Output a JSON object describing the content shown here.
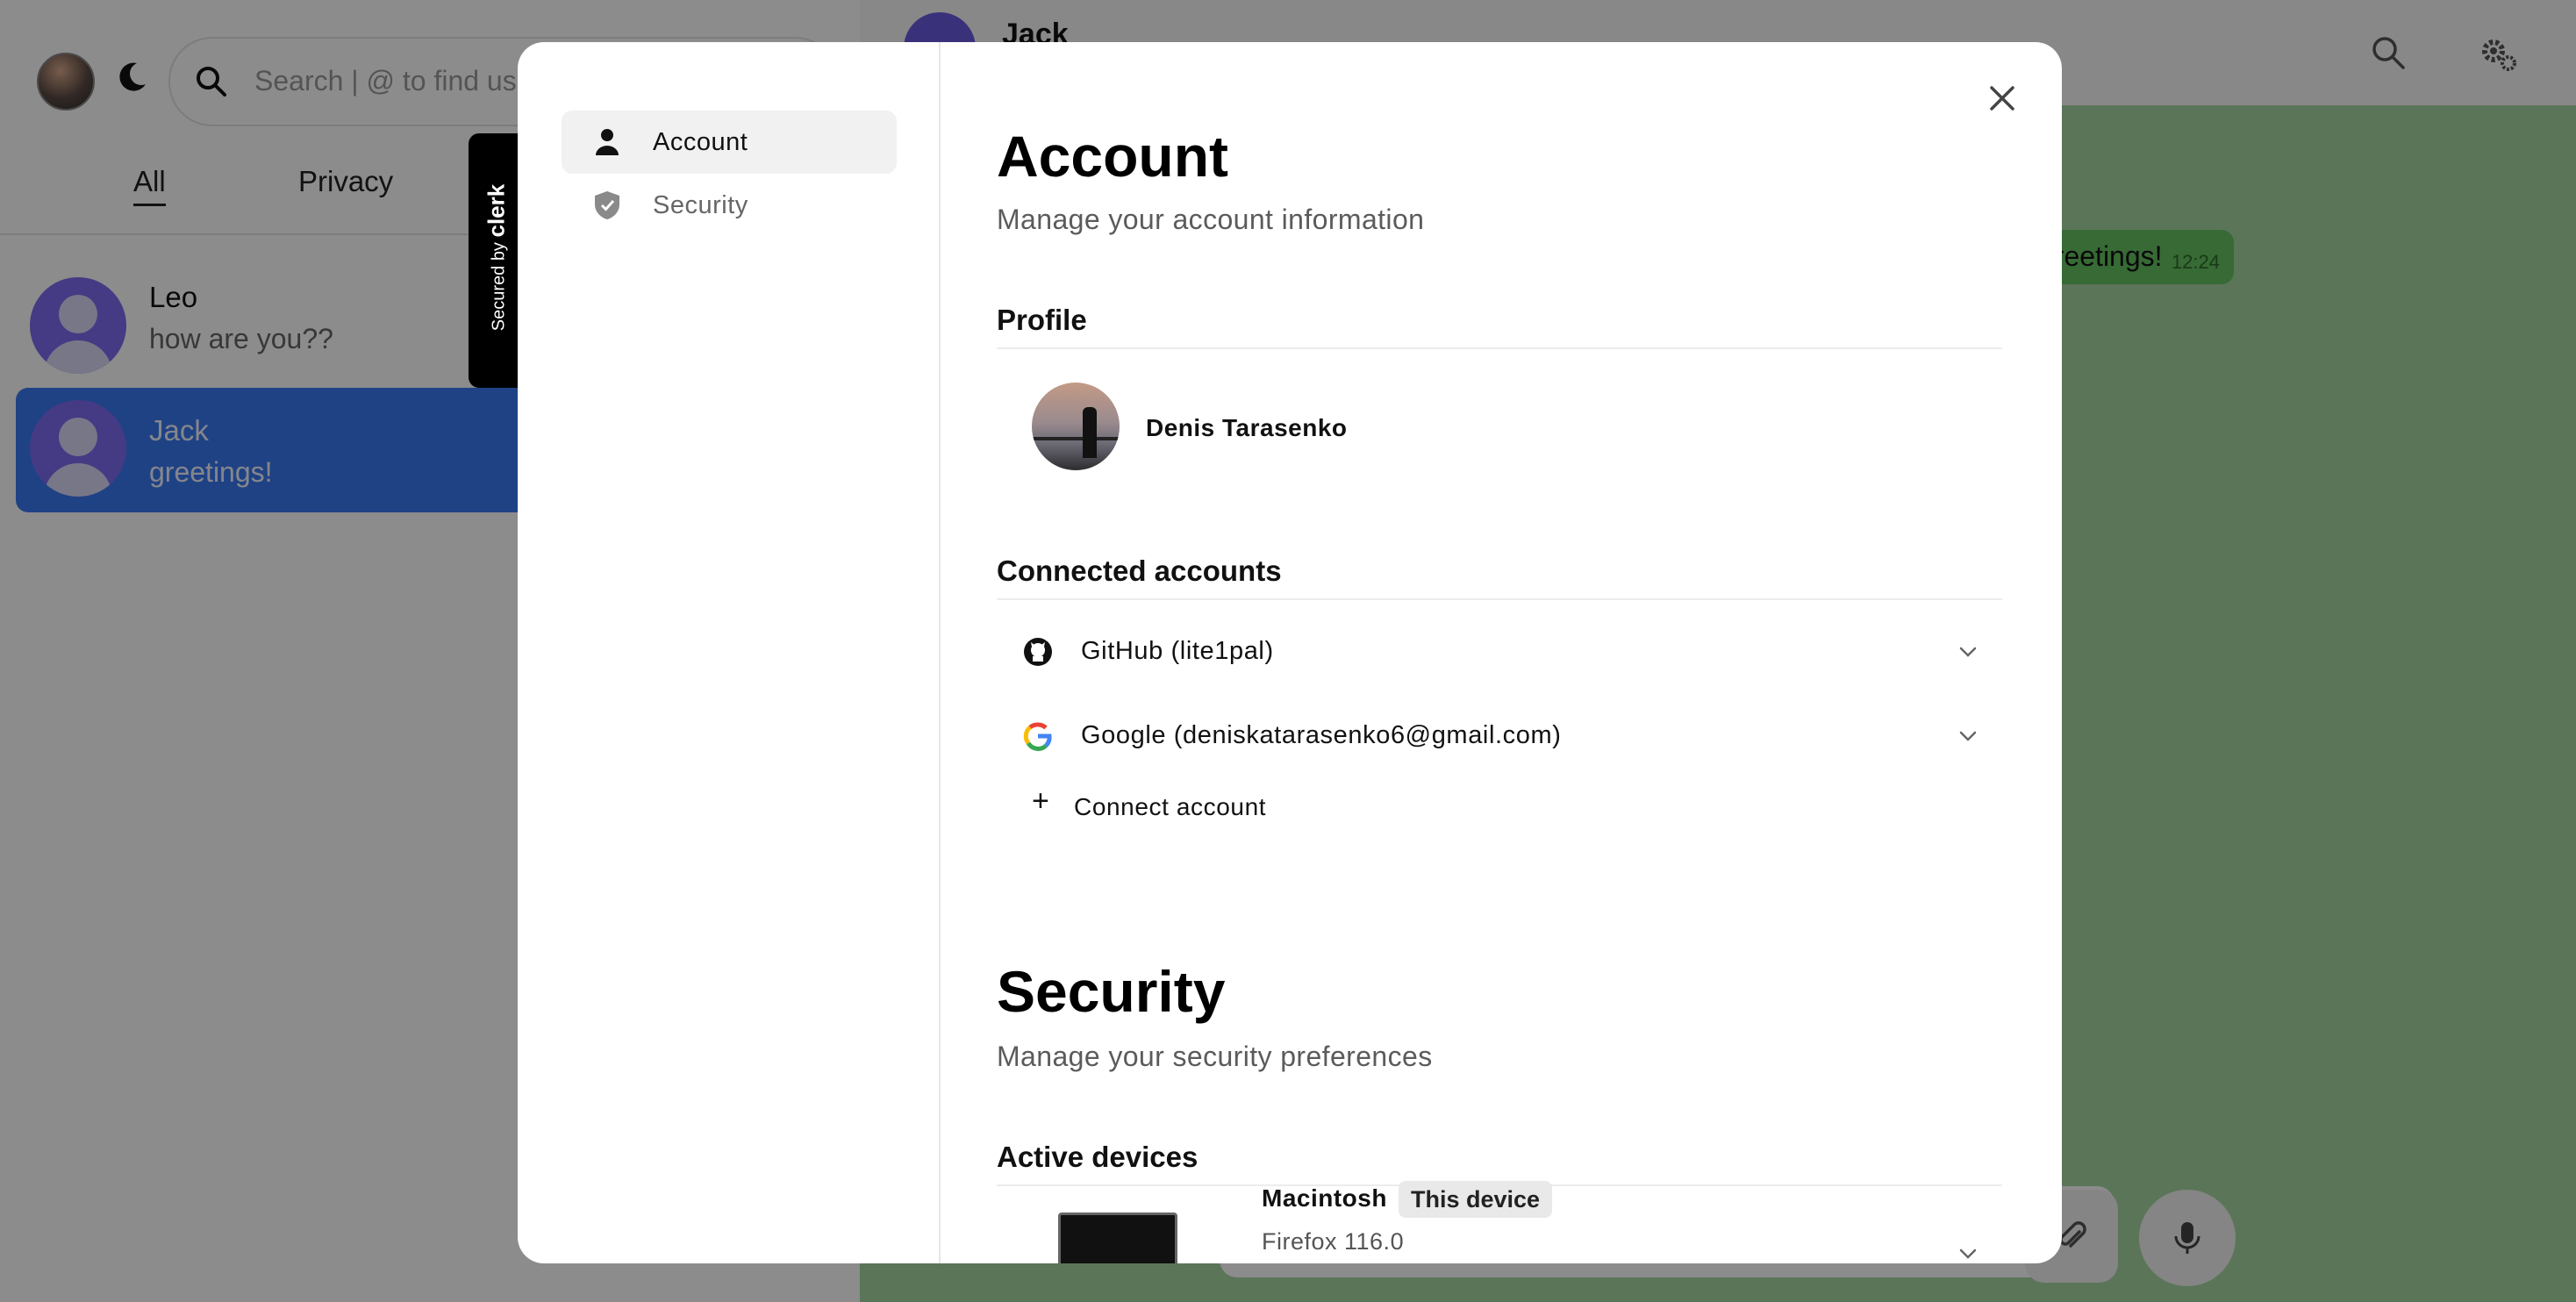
{
  "app": {
    "search_placeholder": "Search | @ to find us",
    "tabs": [
      {
        "label": "All"
      },
      {
        "label": "Privacy"
      }
    ],
    "chats": [
      {
        "name": "Leo",
        "last_message": "how are you??"
      },
      {
        "name": "Jack",
        "last_message": "greetings!"
      }
    ],
    "chat_header": {
      "name": "Jack"
    },
    "message": {
      "text": "greetings!",
      "time": "12:24"
    }
  },
  "clerk_badge": {
    "prefix": "Secured by",
    "brand": "clerk"
  },
  "modal": {
    "nav": [
      {
        "label": "Account",
        "icon": "person-icon",
        "active": true
      },
      {
        "label": "Security",
        "icon": "shield-icon",
        "active": false
      }
    ],
    "account": {
      "title": "Account",
      "subtitle": "Manage your account information",
      "profile_heading": "Profile",
      "profile_name": "Denis Tarasenko",
      "connected_heading": "Connected accounts",
      "connected": [
        {
          "label": "GitHub (lite1pal)",
          "icon": "github-icon"
        },
        {
          "label": "Google (deniskatarasenko6@gmail.com)",
          "icon": "google-icon"
        }
      ],
      "connect_label": "Connect account"
    },
    "security": {
      "title": "Security",
      "subtitle": "Manage your security preferences",
      "devices_heading": "Active devices",
      "device": {
        "name": "Macintosh",
        "badge": "This device",
        "browser": "Firefox 116.0"
      }
    }
  }
}
